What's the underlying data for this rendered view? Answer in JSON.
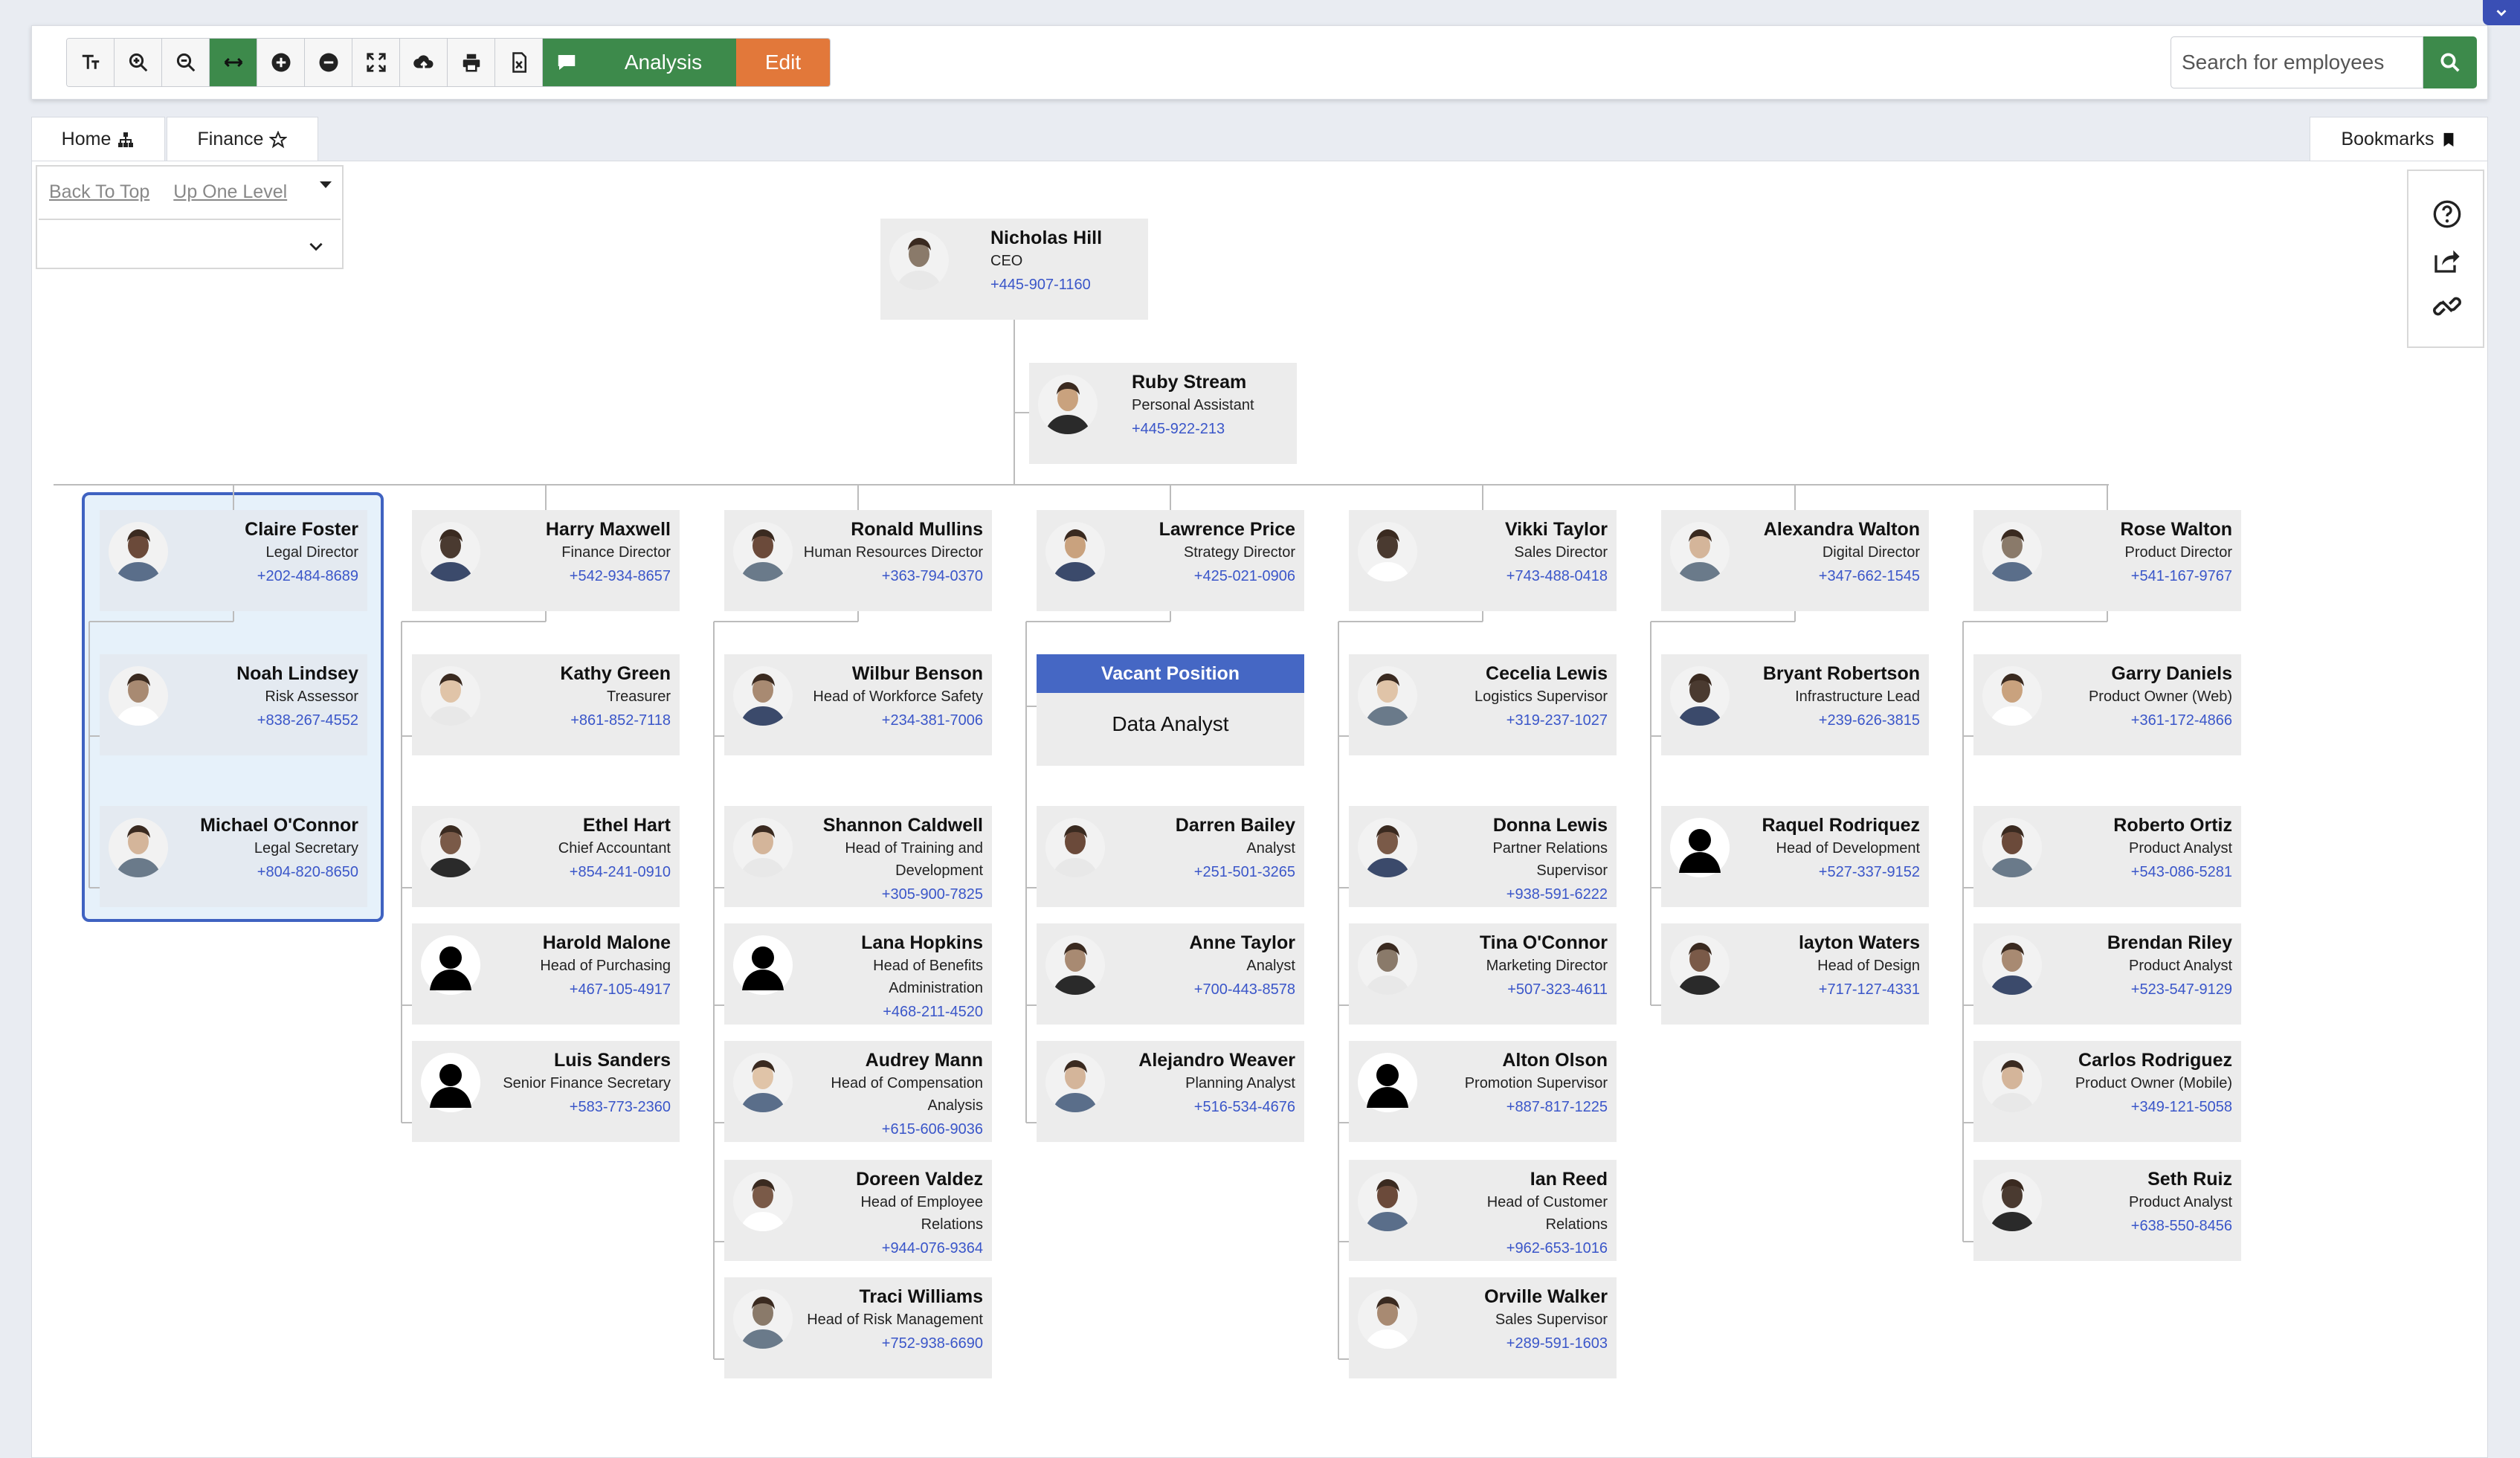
{
  "toolbar": {
    "analysis_label": "Analysis",
    "edit_label": "Edit",
    "tools": [
      "text-size-icon",
      "zoom-in-icon",
      "zoom-out-icon",
      "fit-width-icon",
      "expand-all-icon",
      "collapse-all-icon",
      "fullscreen-icon",
      "upload-icon",
      "print-icon",
      "export-excel-icon"
    ],
    "search_placeholder": "Search for employees"
  },
  "tabs": [
    {
      "label": "Home",
      "icon": "org-chart-icon"
    },
    {
      "label": "Finance",
      "icon": "star-icon"
    }
  ],
  "bookmarks_label": "Bookmarks",
  "nav": {
    "back_to_top": "Back To Top",
    "up_one_level": "Up One Level"
  },
  "colors": {
    "accent_green": "#3d8a4b",
    "edit_orange": "#e2783a",
    "link_blue": "#3a56c9",
    "vacant_blue": "#4567c4"
  },
  "org": {
    "ceo": {
      "name": "Nicholas Hill",
      "role": "CEO",
      "phone": "+445-907-1160"
    },
    "assistant": {
      "name": "Ruby Stream",
      "role": "Personal Assistant",
      "phone": "+445-922-213"
    },
    "directors": [
      {
        "name": "Claire Foster",
        "role": "Legal Director",
        "phone": "+202-484-8689",
        "reports": [
          {
            "name": "Noah Lindsey",
            "role": "Risk Assessor",
            "phone": "+838-267-4552"
          },
          {
            "name": "Michael O'Connor",
            "role": "Legal Secretary",
            "phone": "+804-820-8650"
          }
        ]
      },
      {
        "name": "Harry Maxwell",
        "role": "Finance Director",
        "phone": "+542-934-8657",
        "reports": [
          {
            "name": "Kathy Green",
            "role": "Treasurer",
            "phone": "+861-852-7118"
          },
          {
            "name": "Ethel Hart",
            "role": "Chief Accountant",
            "phone": "+854-241-0910"
          },
          {
            "name": "Harold Malone",
            "role": "Head of Purchasing",
            "phone": "+467-105-4917"
          },
          {
            "name": "Luis Sanders",
            "role": "Senior Finance Secretary",
            "phone": "+583-773-2360"
          }
        ]
      },
      {
        "name": "Ronald Mullins",
        "role": "Human Resources Director",
        "phone": "+363-794-0370",
        "reports": [
          {
            "name": "Wilbur Benson",
            "role": "Head of Workforce Safety",
            "phone": "+234-381-7006"
          },
          {
            "name": "Shannon Caldwell",
            "role": "Head of Training and Development",
            "phone": "+305-900-7825"
          },
          {
            "name": "Lana Hopkins",
            "role": "Head of Benefits Administration",
            "phone": "+468-211-4520"
          },
          {
            "name": "Audrey Mann",
            "role": "Head of Compensation Analysis",
            "phone": "+615-606-9036"
          },
          {
            "name": "Doreen Valdez",
            "role": "Head of Employee Relations",
            "phone": "+944-076-9364"
          },
          {
            "name": "Traci Williams",
            "role": "Head of Risk Management",
            "phone": "+752-938-6690"
          }
        ]
      },
      {
        "name": "Lawrence Price",
        "role": "Strategy Director",
        "phone": "+425-021-0906",
        "vacant": {
          "header": "Vacant Position",
          "title": "Data Analyst"
        },
        "reports": [
          {
            "name": "Darren Bailey",
            "role": "Analyst",
            "phone": "+251-501-3265"
          },
          {
            "name": "Anne Taylor",
            "role": "Analyst",
            "phone": "+700-443-8578"
          },
          {
            "name": "Alejandro Weaver",
            "role": "Planning Analyst",
            "phone": "+516-534-4676"
          }
        ]
      },
      {
        "name": "Vikki Taylor",
        "role": "Sales Director",
        "phone": "+743-488-0418",
        "reports": [
          {
            "name": "Cecelia Lewis",
            "role": "Logistics Supervisor",
            "phone": "+319-237-1027"
          },
          {
            "name": "Donna Lewis",
            "role": "Partner Relations Supervisor",
            "phone": "+938-591-6222"
          },
          {
            "name": "Tina O'Connor",
            "role": "Marketing Director",
            "phone": "+507-323-4611"
          },
          {
            "name": "Alton Olson",
            "role": "Promotion Supervisor",
            "phone": "+887-817-1225"
          },
          {
            "name": "Ian Reed",
            "role": "Head of Customer Relations",
            "phone": "+962-653-1016"
          },
          {
            "name": "Orville Walker",
            "role": "Sales Supervisor",
            "phone": "+289-591-1603"
          }
        ]
      },
      {
        "name": "Alexandra Walton",
        "role": "Digital Director",
        "phone": "+347-662-1545",
        "reports": [
          {
            "name": "Bryant Robertson",
            "role": "Infrastructure Lead",
            "phone": "+239-626-3815"
          },
          {
            "name": "Raquel Rodriquez",
            "role": "Head of Development",
            "phone": "+527-337-9152"
          },
          {
            "name": "layton Waters",
            "role": "Head of Design",
            "phone": "+717-127-4331"
          }
        ]
      },
      {
        "name": "Rose Walton",
        "role": "Product Director",
        "phone": "+541-167-9767",
        "reports": [
          {
            "name": "Garry Daniels",
            "role": "Product Owner (Web)",
            "phone": "+361-172-4866"
          },
          {
            "name": "Roberto Ortiz",
            "role": "Product Analyst",
            "phone": "+543-086-5281"
          },
          {
            "name": "Brendan Riley",
            "role": "Product Analyst",
            "phone": "+523-547-9129"
          },
          {
            "name": "Carlos Rodriguez",
            "role": "Product Owner (Mobile)",
            "phone": "+349-121-5058"
          },
          {
            "name": "Seth Ruiz",
            "role": "Product Analyst",
            "phone": "+638-550-8456"
          }
        ]
      }
    ]
  }
}
